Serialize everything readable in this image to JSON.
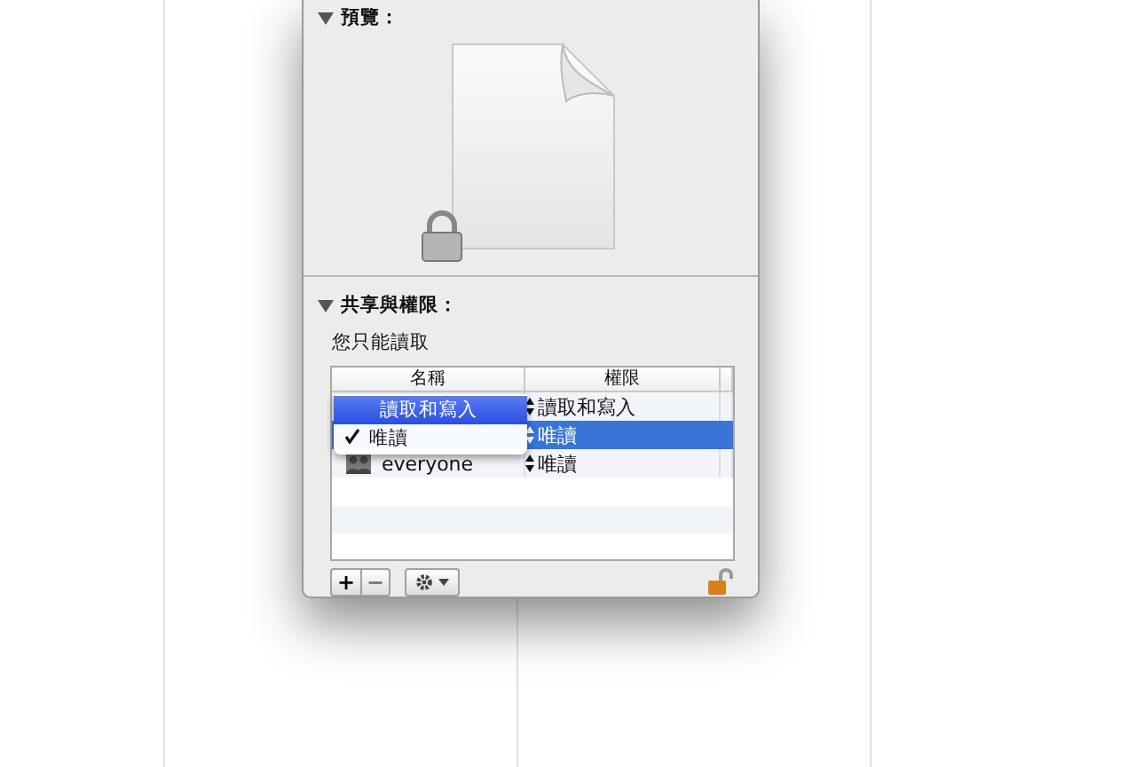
{
  "preview": {
    "title": "預覽：",
    "expanded": true
  },
  "sharing": {
    "title": "共享與權限：",
    "expanded": true,
    "note": "您只能讀取",
    "table": {
      "columns": [
        "名稱",
        "權限"
      ],
      "rows": [
        {
          "permission": "讀取和寫入",
          "selected": false
        },
        {
          "permission": "唯讀",
          "selected": true
        },
        {
          "name": "everyone",
          "permission": "唯讀",
          "selected": false
        }
      ]
    },
    "popup_menu": {
      "items": [
        {
          "label": "讀取和寫入",
          "selected": true,
          "checked": false
        },
        {
          "label": "唯讀",
          "selected": false,
          "checked": true
        }
      ]
    },
    "buttons": [
      "+",
      "−"
    ]
  }
}
